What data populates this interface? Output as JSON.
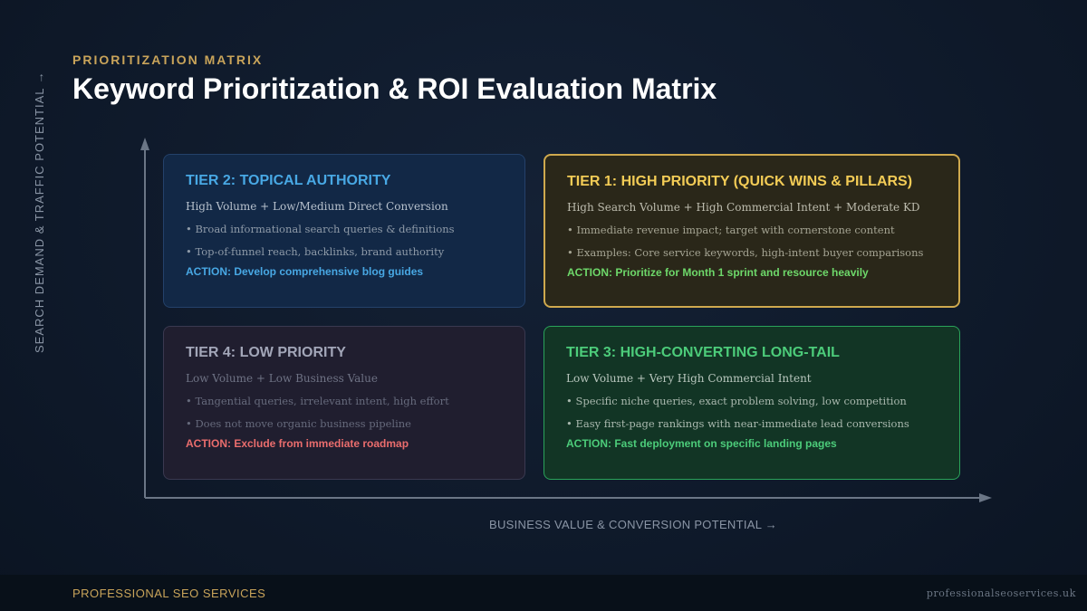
{
  "header": {
    "eyebrow": "PRIORITIZATION MATRIX",
    "title": "Keyword Prioritization & ROI Evaluation Matrix"
  },
  "axes": {
    "y_label": "SEARCH DEMAND & TRAFFIC POTENTIAL →",
    "x_label": "BUSINESS VALUE & CONVERSION POTENTIAL →"
  },
  "quadrants": {
    "tier2": {
      "title": "TIER 2: TOPICAL AUTHORITY",
      "subtitle": "High Volume + Low/Medium Direct Conversion",
      "bullets": [
        "Broad informational search queries & definitions",
        "Top-of-funnel reach, backlinks, brand authority"
      ],
      "action": "ACTION: Develop comprehensive blog guides"
    },
    "tier1": {
      "title": "TIER 1: HIGH PRIORITY (QUICK WINS & PILLARS)",
      "subtitle": "High Search Volume + High Commercial Intent + Moderate KD",
      "bullets": [
        "Immediate revenue impact; target with cornerstone content",
        "Examples: Core service keywords, high-intent buyer comparisons"
      ],
      "action": "ACTION: Prioritize for Month 1 sprint and resource heavily"
    },
    "tier4": {
      "title": "TIER 4: LOW PRIORITY",
      "subtitle": "Low Volume + Low Business Value",
      "bullets": [
        "Tangential queries, irrelevant intent, high effort",
        "Does not move organic business pipeline"
      ],
      "action": "ACTION: Exclude from immediate roadmap"
    },
    "tier3": {
      "title": "TIER 3: HIGH-CONVERTING LONG-TAIL",
      "subtitle": "Low Volume + Very High Commercial Intent",
      "bullets": [
        "Specific niche queries, exact problem solving, low competition",
        "Easy first-page rankings with near-immediate lead conversions"
      ],
      "action": "ACTION: Fast deployment on specific landing pages"
    }
  },
  "footer": {
    "brand": "PROFESSIONAL SEO SERVICES",
    "url": "professionalseoservices.uk"
  },
  "colors": {
    "gold": "#c9a45a",
    "tier1": "#f3cc56",
    "tier2": "#48a8e4",
    "tier3": "#4ccc7a",
    "tier4": "#a2a6b8",
    "action_red": "#ea6d6d"
  }
}
